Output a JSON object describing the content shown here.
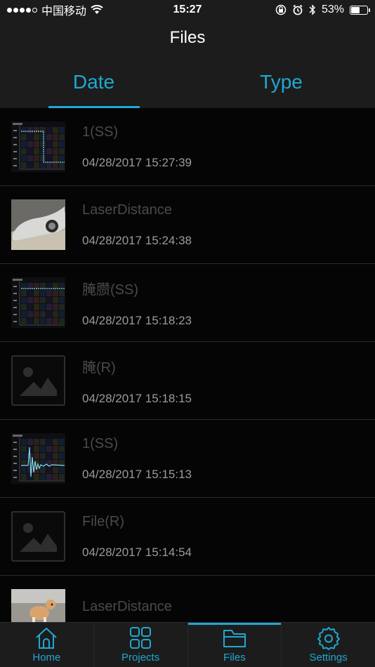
{
  "status": {
    "carrier": "中国移动",
    "time": "15:27",
    "battery": "53%",
    "battery_level": 0.53,
    "signal_bars": 4
  },
  "nav": {
    "title": "Files"
  },
  "tabs": [
    {
      "label": "Date",
      "active": true
    },
    {
      "label": "Type",
      "active": false
    }
  ],
  "files": [
    {
      "name": "1(SS)",
      "date": "04/28/2017 15:27:39",
      "thumb": "chart-step"
    },
    {
      "name": "LaserDistance",
      "date": "04/28/2017 15:24:38",
      "thumb": "photo-car"
    },
    {
      "name": "腌臜(SS)",
      "date": "04/28/2017 15:18:23",
      "thumb": "chart-flat"
    },
    {
      "name": "腌(R)",
      "date": "04/28/2017 15:18:15",
      "thumb": "placeholder"
    },
    {
      "name": "1(SS)",
      "date": "04/28/2017 15:15:13",
      "thumb": "chart-wave"
    },
    {
      "name": "File(R)",
      "date": "04/28/2017 15:14:54",
      "thumb": "placeholder"
    },
    {
      "name": "LaserDistance",
      "date": "",
      "thumb": "photo-dog"
    }
  ],
  "tabbar": [
    {
      "label": "Home",
      "icon": "home-icon",
      "active": false
    },
    {
      "label": "Projects",
      "icon": "grid-icon",
      "active": false
    },
    {
      "label": "Files",
      "icon": "folder-icon",
      "active": true
    },
    {
      "label": "Settings",
      "icon": "gear-icon",
      "active": false
    }
  ],
  "colors": {
    "accent": "#20a8d0",
    "background": "#050505",
    "bar": "#1c1c1c"
  }
}
